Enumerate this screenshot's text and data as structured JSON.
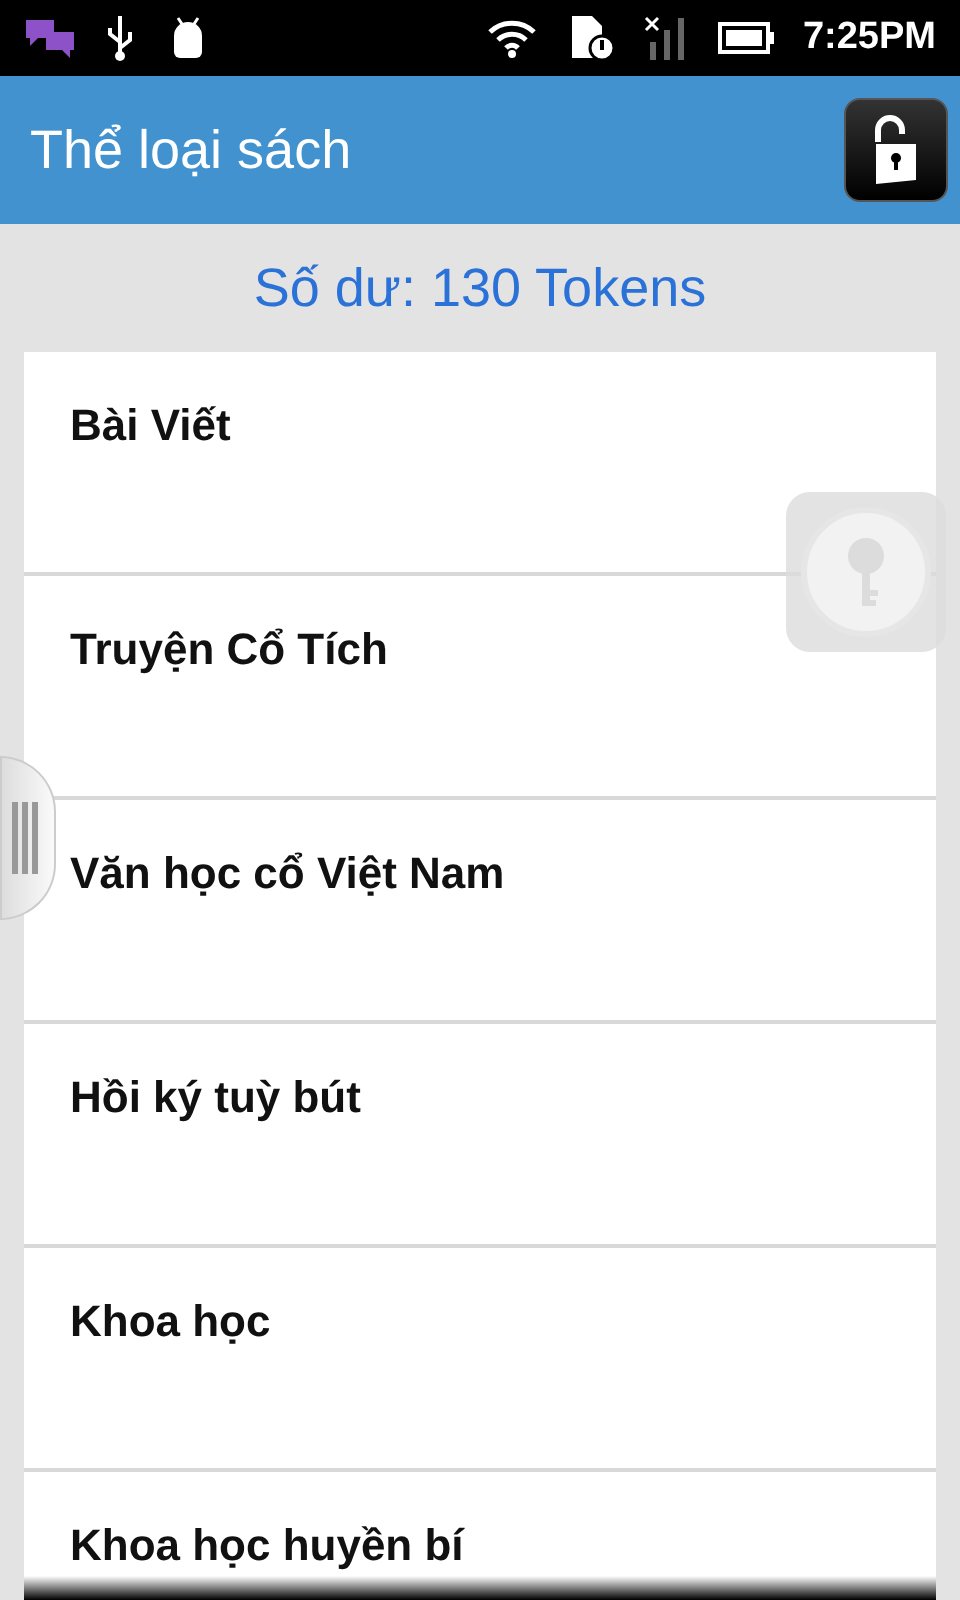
{
  "status_bar": {
    "time": "7:25PM"
  },
  "app_bar": {
    "title": "Thể loại sách"
  },
  "balance": "Số dư: 130 Tokens",
  "categories": [
    {
      "label": "Bài Viết"
    },
    {
      "label": "Truyện Cổ Tích"
    },
    {
      "label": "Văn học cổ Việt Nam"
    },
    {
      "label": "Hồi ký tuỳ bút"
    },
    {
      "label": "Khoa học"
    },
    {
      "label": "Khoa học huyền bí"
    }
  ]
}
